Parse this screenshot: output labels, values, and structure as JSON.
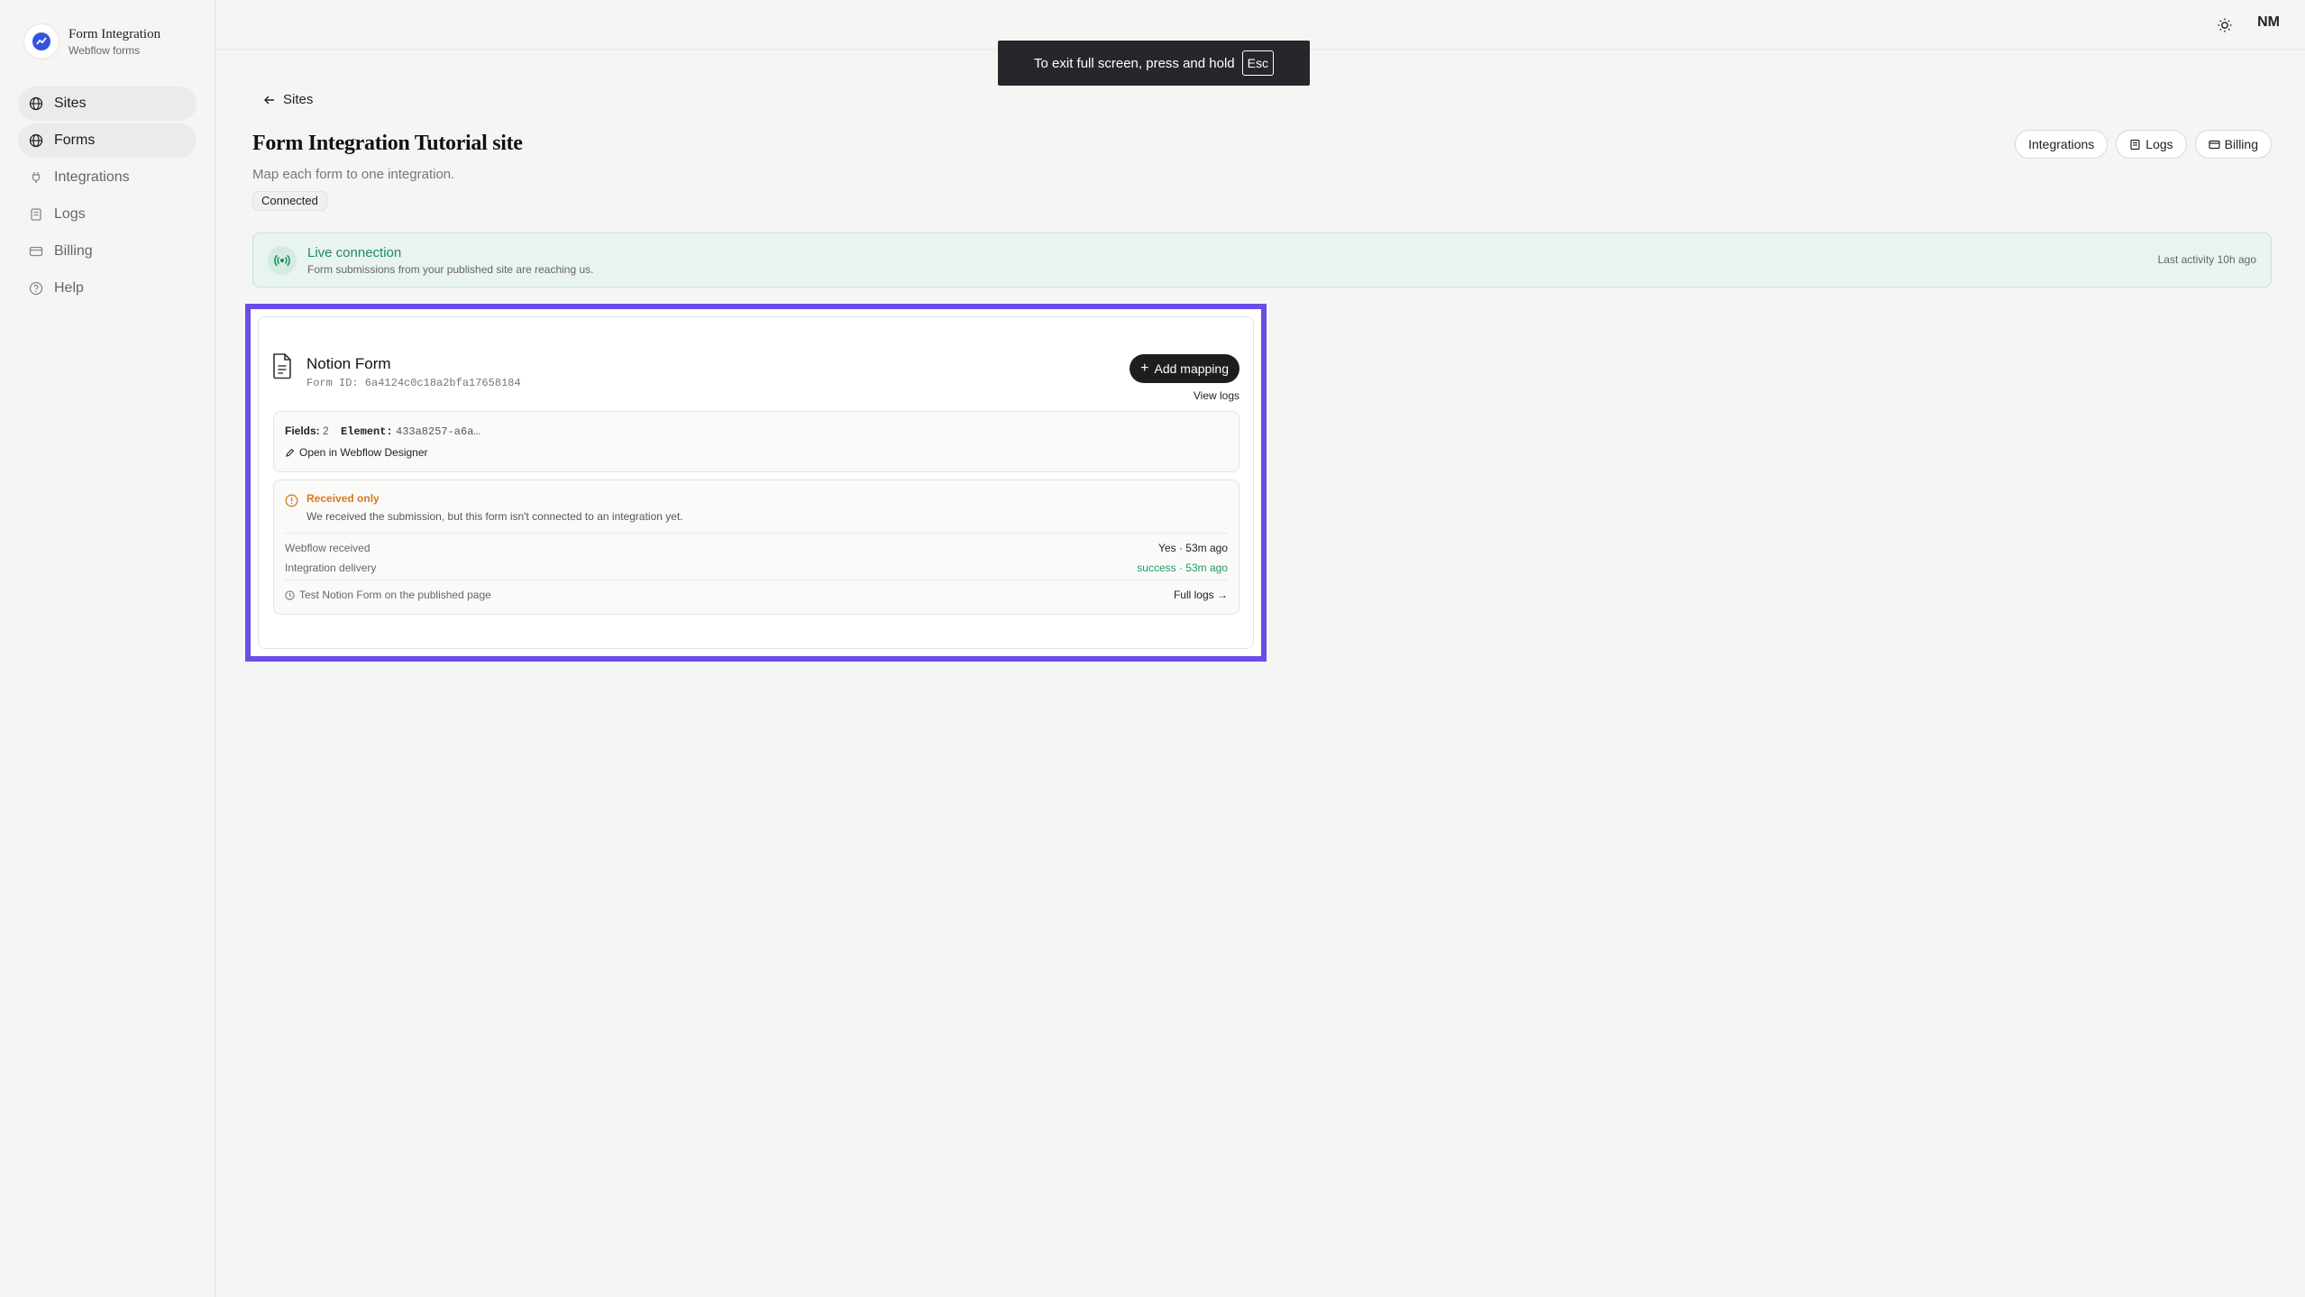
{
  "brand": {
    "title": "Form Integration",
    "subtitle": "Webflow forms"
  },
  "nav": [
    {
      "label": "Sites",
      "icon": "globe-icon",
      "active": true
    },
    {
      "label": "Forms",
      "icon": "globe-icon",
      "active": true
    },
    {
      "label": "Integrations",
      "icon": "plug-icon",
      "active": false
    },
    {
      "label": "Logs",
      "icon": "scroll-icon",
      "active": false
    },
    {
      "label": "Billing",
      "icon": "card-icon",
      "active": false
    },
    {
      "label": "Help",
      "icon": "help-icon",
      "active": false
    }
  ],
  "topbar": {
    "user_initials": "NM",
    "theme_icon": "sun-icon"
  },
  "fullscreen": {
    "message": "To exit full screen, press and hold",
    "key": "Esc"
  },
  "page": {
    "back_label": "Sites",
    "title": "Form Integration Tutorial site",
    "subtitle": "Map each form to one integration.",
    "status": "Connected",
    "actions": {
      "integrations": "Integrations",
      "logs": "Logs",
      "billing": "Billing"
    }
  },
  "live": {
    "title": "Live connection",
    "subtitle": "Form submissions from your published site are reaching us.",
    "last_activity": "Last activity 10h ago"
  },
  "form_card": {
    "name": "Notion Form",
    "form_id": "Form ID: 6a4124c0c18a2bfa17658184",
    "add_mapping": "Add mapping",
    "view_logs": "View logs",
    "fields_label": "Fields:",
    "fields_value": "2",
    "element_label": "Element:",
    "element_value": "433a8257-a6a…",
    "open_designer": "Open in Webflow Designer",
    "status": {
      "title": "Received only",
      "message": "We received the submission, but this form isn't connected to an integration yet.",
      "webflow_received_label": "Webflow received",
      "webflow_received_value": "Yes · 53m ago",
      "delivery_label": "Integration delivery",
      "delivery_value": "success · 53m ago",
      "test_hint": "Test Notion Form on the published page",
      "full_logs": "Full logs →"
    }
  },
  "colors": {
    "accent_highlight": "#6b4ce6",
    "success": "#1f8a5d",
    "warning": "#d97a1c"
  }
}
